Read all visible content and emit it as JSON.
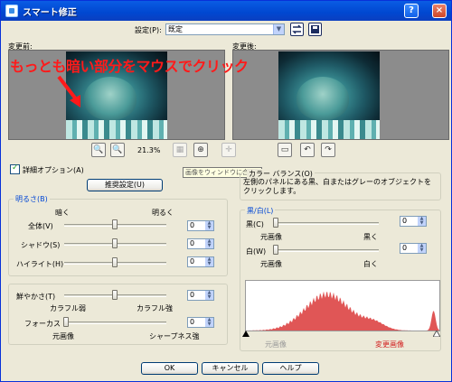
{
  "window": {
    "title": "スマート修正",
    "help_label": "?",
    "close_label": "×"
  },
  "preset": {
    "label": "設定(P):",
    "value": "既定"
  },
  "preview": {
    "before_label": "変更前:",
    "after_label": "変更後:",
    "annotation": "もっとも暗い部分をマウスでクリック",
    "zoom_value": "21.3%"
  },
  "options": {
    "detail_label": "詳細オプション(A)",
    "detail_checked": true,
    "suggest_button": "推奨設定(U)"
  },
  "tooltip": "画像をウィンドウに合わせる",
  "color_balance": {
    "title": "カラー バランス(O)",
    "description": "左側のパネルにある黒、白またはグレーのオブジェクトをクリックします。"
  },
  "brightness": {
    "title": "明るさ(B)",
    "dark_label": "暗く",
    "bright_label": "明るく",
    "rows": [
      {
        "label": "全体(V)",
        "value": "0"
      },
      {
        "label": "シャドウ(S)",
        "value": "0"
      },
      {
        "label": "ハイライト(H)",
        "value": "0"
      }
    ]
  },
  "saturation": {
    "label": "鮮やかさ(T)",
    "value": "0",
    "min_label": "カラフル弱",
    "max_label": "カラフル強"
  },
  "focus": {
    "label": "フォーカス",
    "value": "0",
    "min_label": "元画像",
    "max_label": "シャープネス強"
  },
  "blackwhite": {
    "title": "黒/白(L)",
    "black": {
      "label": "黒(C)",
      "value": "0",
      "min_label": "元画像",
      "max_label": "黒く"
    },
    "white": {
      "label": "白(W)",
      "value": "0",
      "min_label": "元画像",
      "max_label": "白く"
    },
    "histogram_left_label": "元画像",
    "histogram_right_label": "変更画像"
  },
  "footer": {
    "ok": "OK",
    "cancel": "キャンセル",
    "help": "ヘルプ"
  },
  "colors": {
    "accent": "#0046d5",
    "histogram": "#e05656",
    "annotation": "#ff1a1a"
  }
}
